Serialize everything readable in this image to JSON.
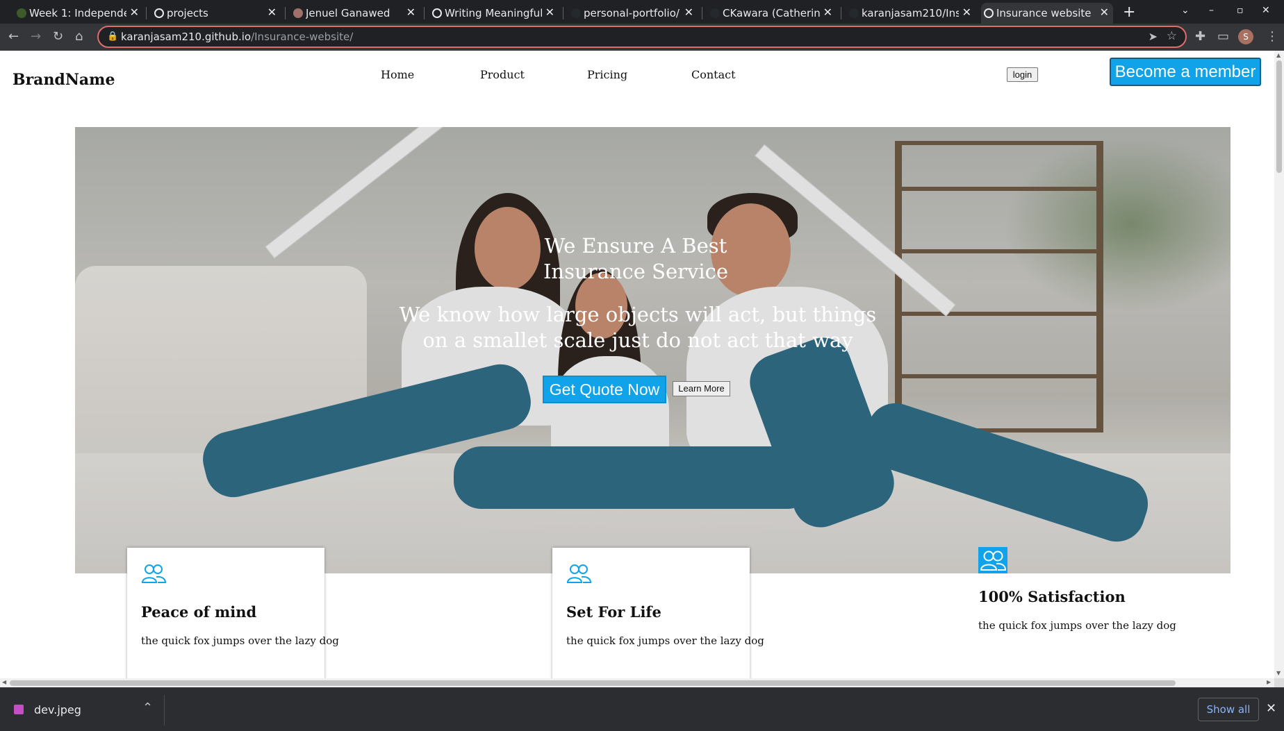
{
  "browser": {
    "tabs": [
      {
        "title": "Week 1: Independen",
        "active": false
      },
      {
        "title": "projects",
        "active": false
      },
      {
        "title": "Jenuel Ganawed",
        "active": false
      },
      {
        "title": "Writing Meaningful",
        "active": false
      },
      {
        "title": "personal-portfolio/",
        "active": false
      },
      {
        "title": "CKawara (Catherine",
        "active": false
      },
      {
        "title": "karanjasam210/Insu",
        "active": false
      },
      {
        "title": "Insurance website",
        "active": true
      }
    ],
    "url_domain": "karanjasam210.github.io",
    "url_path": "/Insurance-website/",
    "profile_initial": "S"
  },
  "site": {
    "brand": "BrandName",
    "nav": [
      "Home",
      "Product",
      "Pricing",
      "Contact"
    ],
    "login_label": "login",
    "member_label": "Become a member",
    "accent_color": "#10a3e9"
  },
  "hero": {
    "title_line1": "We Ensure A Best",
    "title_line2": "Insurance Service",
    "subtitle": "We know how large objects will act, but things on a smallet scale just do not act that way",
    "quote_label": "Get Quote Now",
    "learn_label": "Learn More"
  },
  "features": [
    {
      "icon": "users-icon",
      "title": "Peace of mind",
      "desc": "the quick fox jumps over the lazy dog"
    },
    {
      "icon": "users-icon",
      "title": "Set For Life",
      "desc": "the quick fox jumps over the lazy dog"
    },
    {
      "icon": "users-icon",
      "title": "100% Satisfaction",
      "desc": "the quick fox jumps over the lazy dog"
    }
  ],
  "downloads": {
    "file_name": "dev.jpeg",
    "show_all_label": "Show all"
  }
}
